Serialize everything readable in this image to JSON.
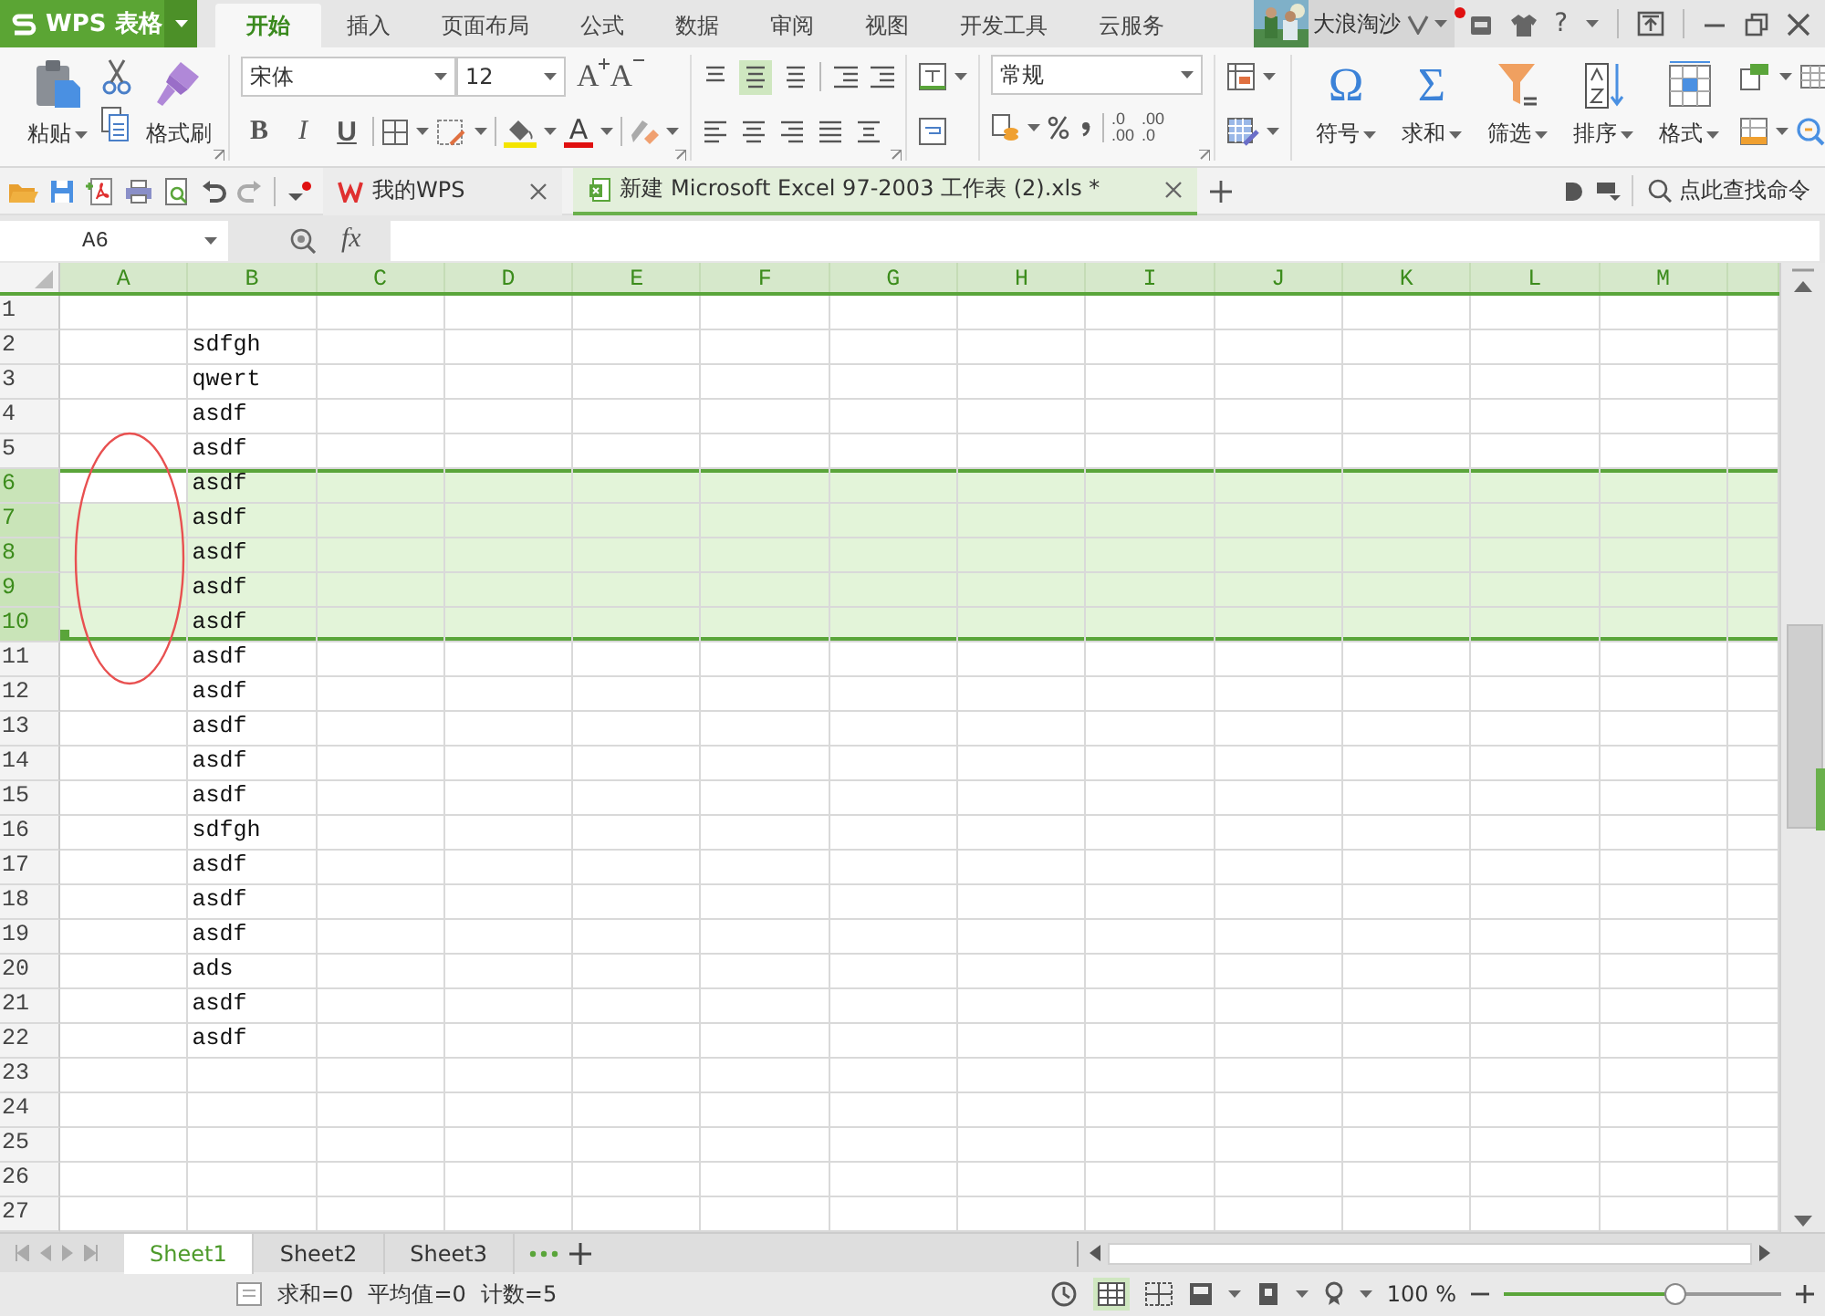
{
  "app": {
    "title": "WPS 表格"
  },
  "menu_tabs": [
    {
      "label": "开始",
      "selected": true
    },
    {
      "label": "插入",
      "selected": false
    },
    {
      "label": "页面布局",
      "selected": false
    },
    {
      "label": "公式",
      "selected": false
    },
    {
      "label": "数据",
      "selected": false
    },
    {
      "label": "审阅",
      "selected": false
    },
    {
      "label": "视图",
      "selected": false
    },
    {
      "label": "开发工具",
      "selected": false
    },
    {
      "label": "云服务",
      "selected": false
    }
  ],
  "account": {
    "name": "大浪淘沙",
    "notification": true
  },
  "help": "?",
  "ribbon": {
    "paste": "粘贴",
    "format_painter": "格式刷",
    "font": "宋体",
    "font_size": "12",
    "font_buttons": {
      "grow": "A",
      "shrink": "A",
      "bold": "B",
      "italic": "I",
      "underline": "U",
      "font_color": "A"
    },
    "number_format": "常规",
    "decimal_buttons": [
      {
        "top": ".0",
        "bottom": ".00"
      },
      {
        "top": ".00",
        "bottom": ".0"
      }
    ],
    "big_buttons": [
      {
        "kind": "symbol",
        "glyph": "Ω",
        "label": "符号"
      },
      {
        "kind": "sum",
        "glyph": "Σ",
        "label": "求和"
      },
      {
        "kind": "filter",
        "label": "筛选"
      },
      {
        "kind": "sort",
        "label": "排序"
      },
      {
        "kind": "format",
        "label": "格式"
      }
    ]
  },
  "documents": [
    {
      "kind": "home",
      "title": "我的WPS",
      "selected": false
    },
    {
      "kind": "sheet",
      "title": "新建 Microsoft Excel 97-2003 工作表 (2).xls *",
      "selected": true
    }
  ],
  "command_search": {
    "placeholder": "点此查找命令"
  },
  "name_box": "A6",
  "formula_label": "fx",
  "columns": [
    "A",
    "B",
    "C",
    "D",
    "E",
    "F",
    "G",
    "H",
    "I",
    "J",
    "K",
    "L",
    "M"
  ],
  "rows": [
    {
      "number": "1",
      "selected": false,
      "active": false
    },
    {
      "number": "2",
      "column_b": "sdfgh",
      "selected": false,
      "active": false
    },
    {
      "number": "3",
      "column_b": "qwert",
      "selected": false,
      "active": false
    },
    {
      "number": "4",
      "column_b": "asdf",
      "selected": false,
      "active": false
    },
    {
      "number": "5",
      "column_b": "asdf",
      "selected": false,
      "active": false
    },
    {
      "number": "6",
      "column_b": "asdf",
      "selected": true,
      "active": true
    },
    {
      "number": "7",
      "column_b": "asdf",
      "selected": true,
      "active": false
    },
    {
      "number": "8",
      "column_b": "asdf",
      "selected": true,
      "active": false
    },
    {
      "number": "9",
      "column_b": "asdf",
      "selected": true,
      "active": false
    },
    {
      "number": "10",
      "column_b": "asdf",
      "selected": true,
      "active": false
    },
    {
      "number": "11",
      "column_b": "asdf",
      "selected": false,
      "active": false
    },
    {
      "number": "12",
      "column_b": "asdf",
      "selected": false,
      "active": false
    },
    {
      "number": "13",
      "column_b": "asdf",
      "selected": false,
      "active": false
    },
    {
      "number": "14",
      "column_b": "asdf",
      "selected": false,
      "active": false
    },
    {
      "number": "15",
      "column_b": "asdf",
      "selected": false,
      "active": false
    },
    {
      "number": "16",
      "column_b": "sdfgh",
      "selected": false,
      "active": false
    },
    {
      "number": "17",
      "column_b": "asdf",
      "selected": false,
      "active": false
    },
    {
      "number": "18",
      "column_b": "asdf",
      "selected": false,
      "active": false
    },
    {
      "number": "19",
      "column_b": "asdf",
      "selected": false,
      "active": false
    },
    {
      "number": "20",
      "column_b": "ads",
      "selected": false,
      "active": false
    },
    {
      "number": "21",
      "column_b": "asdf",
      "selected": false,
      "active": false
    },
    {
      "number": "22",
      "column_b": "asdf",
      "selected": false,
      "active": false
    },
    {
      "number": "23",
      "selected": false,
      "active": false
    },
    {
      "number": "24",
      "selected": false,
      "active": false
    },
    {
      "number": "25",
      "selected": false,
      "active": false
    },
    {
      "number": "26",
      "selected": false,
      "active": false
    },
    {
      "number": "27",
      "selected": false,
      "active": false
    }
  ],
  "sheets": [
    {
      "label": "Sheet1",
      "selected": true
    },
    {
      "label": "Sheet2",
      "selected": false
    },
    {
      "label": "Sheet3",
      "selected": false
    }
  ],
  "status": [
    "求和=0",
    "平均值=0",
    "计数=5"
  ],
  "zoom": {
    "reading": "100 %",
    "level": 0.62
  }
}
